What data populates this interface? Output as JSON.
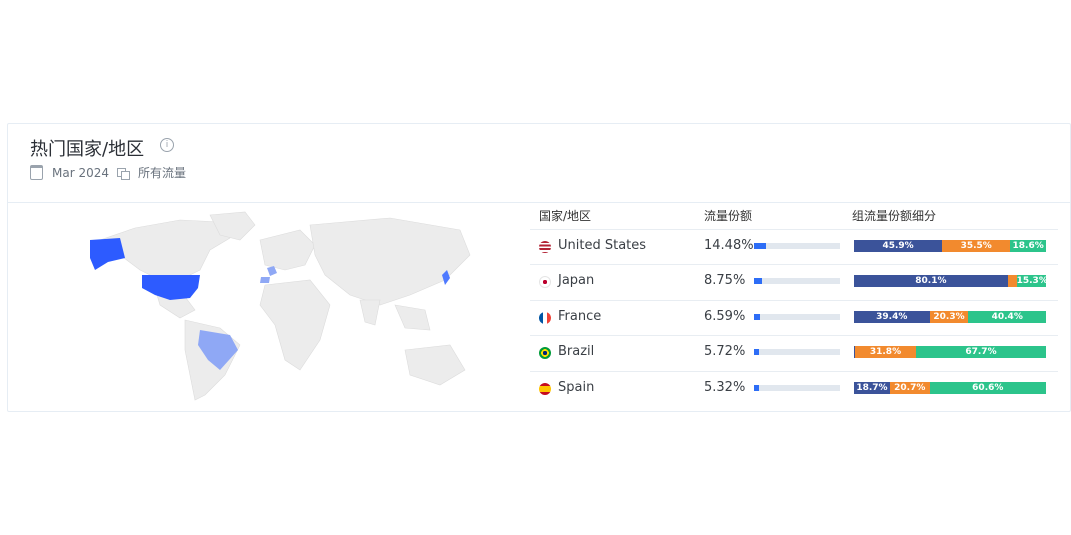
{
  "header": {
    "title": "热门国家/地区",
    "date": "Mar 2024",
    "traffic_type": "所有流量"
  },
  "table": {
    "col_country": "国家/地区",
    "col_share": "流量份额",
    "col_breakdown": "组流量份额细分"
  },
  "rows": [
    {
      "country": "United States",
      "flag": "us-flag-icon",
      "share_label": "14.48%",
      "share": 0.1448,
      "breakdown": [
        {
          "label": "45.9%",
          "v": 45.9,
          "c": "dark"
        },
        {
          "label": "35.5%",
          "v": 35.5,
          "c": "orange"
        },
        {
          "label": "18.6%",
          "v": 18.6,
          "c": "green"
        }
      ]
    },
    {
      "country": "Japan",
      "flag": "jp-flag-icon",
      "share_label": "8.75%",
      "share": 0.0875,
      "breakdown": [
        {
          "label": "80.1%",
          "v": 80.1,
          "c": "dark"
        },
        {
          "label": "",
          "v": 4.6,
          "c": "orange"
        },
        {
          "label": "15.3%",
          "v": 15.3,
          "c": "green"
        }
      ]
    },
    {
      "country": "France",
      "flag": "fr-flag-icon",
      "share_label": "6.59%",
      "share": 0.0659,
      "breakdown": [
        {
          "label": "39.4%",
          "v": 39.4,
          "c": "dark"
        },
        {
          "label": "20.3%",
          "v": 20.3,
          "c": "orange"
        },
        {
          "label": "40.4%",
          "v": 40.4,
          "c": "green"
        }
      ]
    },
    {
      "country": "Brazil",
      "flag": "br-flag-icon",
      "share_label": "5.72%",
      "share": 0.0572,
      "breakdown": [
        {
          "label": "",
          "v": 0.5,
          "c": "dark"
        },
        {
          "label": "31.8%",
          "v": 31.8,
          "c": "orange"
        },
        {
          "label": "67.7%",
          "v": 67.7,
          "c": "green"
        }
      ]
    },
    {
      "country": "Spain",
      "flag": "es-flag-icon",
      "share_label": "5.32%",
      "share": 0.0532,
      "breakdown": [
        {
          "label": "18.7%",
          "v": 18.7,
          "c": "dark"
        },
        {
          "label": "20.7%",
          "v": 20.7,
          "c": "orange"
        },
        {
          "label": "60.6%",
          "v": 60.6,
          "c": "green"
        }
      ]
    }
  ],
  "colors": {
    "accent": "#2d6df6",
    "dark": "#3b539a",
    "orange": "#f28a2e",
    "green": "#2cc48b",
    "map_land": "#ececec",
    "map_highlight": "#2d5bff",
    "map_light": "#8fa8f5"
  }
}
